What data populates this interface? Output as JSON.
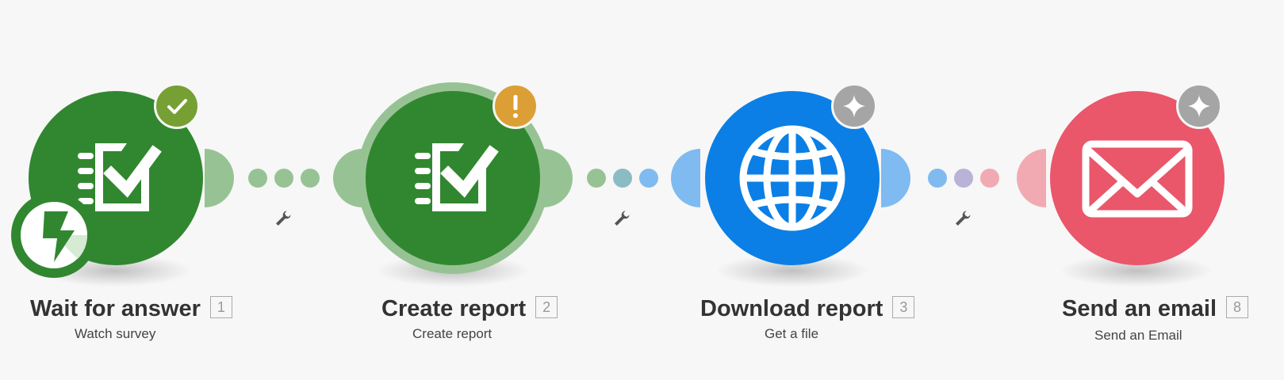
{
  "scenario": {
    "modules": [
      {
        "title": "Wait for answer",
        "subtitle": "Watch survey",
        "number": "1",
        "app_icon": "survey-checklist-icon",
        "status_badge": "check-icon",
        "trigger_badge": "lightning-bolt-icon",
        "color": "#31872f"
      },
      {
        "title": "Create report",
        "subtitle": "Create report",
        "number": "2",
        "app_icon": "survey-checklist-icon",
        "status_badge": "warning-icon",
        "color": "#31872f"
      },
      {
        "title": "Download report",
        "subtitle": "Get a file",
        "number": "3",
        "app_icon": "globe-icon",
        "status_badge": "sparkle-icon",
        "color": "#0b7fe5"
      },
      {
        "title": "Send an email",
        "subtitle": "Send an Email",
        "number": "8",
        "app_icon": "envelope-icon",
        "status_badge": "sparkle-icon",
        "color": "#ea566a"
      }
    ],
    "routes": [
      {
        "name": "route-1-2",
        "icon": "wrench-icon"
      },
      {
        "name": "route-2-3",
        "icon": "wrench-icon"
      },
      {
        "name": "route-3-8",
        "icon": "wrench-icon"
      }
    ],
    "colors": {
      "green": "#31872f",
      "green_light": "#97c394",
      "blue": "#0b7fe5",
      "blue_light": "#7fbaf1",
      "red": "#ea566a",
      "red_light": "#f2aab2",
      "badge_success": "#76a034",
      "badge_warning": "#dc9f35",
      "badge_neutral": "#a5a5a5"
    }
  }
}
